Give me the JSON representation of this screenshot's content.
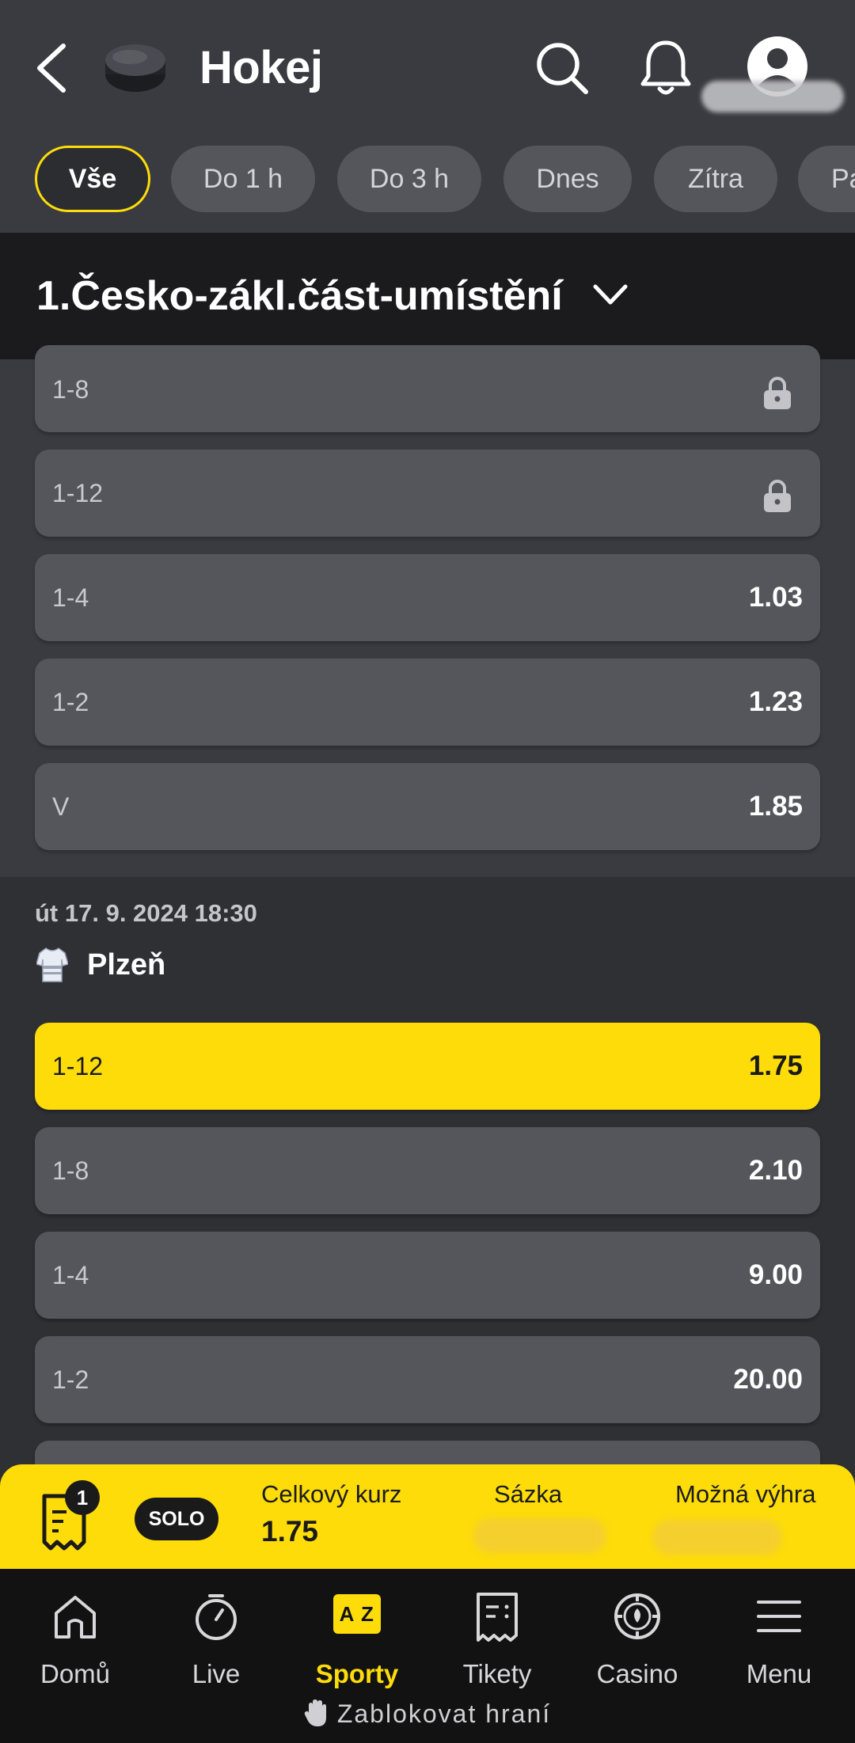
{
  "header": {
    "title": "Hokej"
  },
  "filters": [
    {
      "label": "Vše",
      "active": true
    },
    {
      "label": "Do 1 h"
    },
    {
      "label": "Do 3 h"
    },
    {
      "label": "Dnes"
    },
    {
      "label": "Zítra"
    },
    {
      "label": "Pa"
    }
  ],
  "league": {
    "title": "1.Česko-zákl.část-umístění"
  },
  "markets_prev": [
    {
      "label": "1-8",
      "locked": true
    },
    {
      "label": "1-12",
      "locked": true
    },
    {
      "label": "1-4",
      "odd": "1.03"
    },
    {
      "label": "1-2",
      "odd": "1.23"
    },
    {
      "label": "V",
      "odd": "1.85"
    }
  ],
  "event": {
    "date": "út 17. 9. 2024 18:30",
    "team": "Plzeň",
    "markets": [
      {
        "label": "1-12",
        "odd": "1.75",
        "selected": true
      },
      {
        "label": "1-8",
        "odd": "2.10"
      },
      {
        "label": "1-4",
        "odd": "9.00"
      },
      {
        "label": "1-2",
        "odd": "20.00"
      }
    ]
  },
  "betslip": {
    "count": "1",
    "mode": "SOLO",
    "total_odds_label": "Celkový kurz",
    "total_odds": "1.75",
    "stake_label": "Sázka",
    "win_label": "Možná výhra"
  },
  "nav": [
    {
      "label": "Domů",
      "icon": "home-icon"
    },
    {
      "label": "Live",
      "icon": "stopwatch-icon"
    },
    {
      "label": "Sporty",
      "icon": "az-icon",
      "active": true
    },
    {
      "label": "Tikety",
      "icon": "ticket-icon"
    },
    {
      "label": "Casino",
      "icon": "casino-chip-icon"
    },
    {
      "label": "Menu",
      "icon": "menu-icon"
    }
  ],
  "block_play": "Zablokovat hraní",
  "colors": {
    "accent": "#fddc0a",
    "background": "#2f3034",
    "row": "#55565b"
  }
}
